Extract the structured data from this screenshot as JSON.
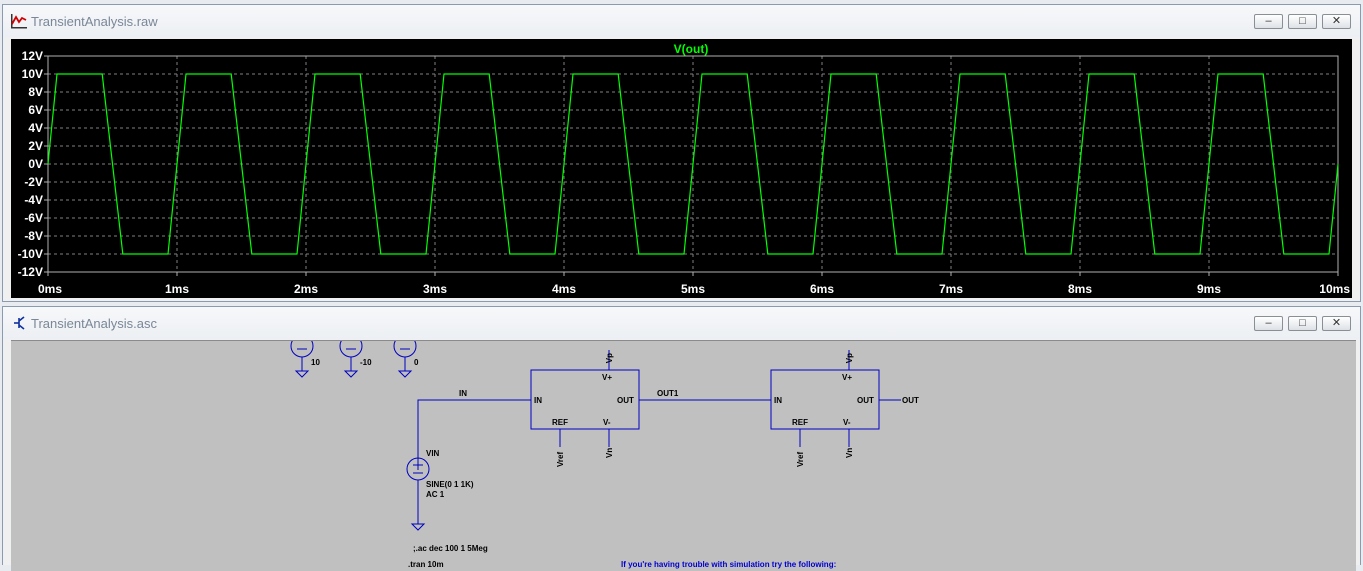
{
  "waveform_window": {
    "title": "TransientAnalysis.raw",
    "trace_label": "V(out)",
    "trace_color": "#00ff00",
    "buttons": {
      "minimize": "–",
      "restore": "□",
      "close": "✕"
    }
  },
  "chart_data": {
    "type": "line",
    "title": "V(out)",
    "xlabel": "",
    "ylabel": "",
    "x_ticks": [
      "0ms",
      "1ms",
      "2ms",
      "3ms",
      "4ms",
      "5ms",
      "6ms",
      "7ms",
      "8ms",
      "9ms",
      "10ms"
    ],
    "y_ticks": [
      "12V",
      "10V",
      "8V",
      "6V",
      "4V",
      "2V",
      "0V",
      "-2V",
      "-4V",
      "-6V",
      "-8V",
      "-10V",
      "-12V"
    ],
    "xlim": [
      0,
      10
    ],
    "ylim": [
      -12,
      12
    ],
    "grid": true,
    "series": [
      {
        "name": "V(out)",
        "x_units": "ms",
        "y_units": "V",
        "x": [
          0,
          0.07,
          0.42,
          0.58,
          0.93,
          1.07,
          1.42,
          1.58,
          1.93,
          2.07,
          2.42,
          2.58,
          2.93,
          3.07,
          3.42,
          3.58,
          3.93,
          4.07,
          4.42,
          4.58,
          4.93,
          5.07,
          5.42,
          5.58,
          5.93,
          6.07,
          6.42,
          6.58,
          6.93,
          7.07,
          7.42,
          7.58,
          7.93,
          8.07,
          8.42,
          8.58,
          8.93,
          9.07,
          9.42,
          9.58,
          9.93,
          10
        ],
        "y": [
          0,
          10,
          10,
          -10,
          -10,
          10,
          10,
          -10,
          -10,
          10,
          10,
          -10,
          -10,
          10,
          10,
          -10,
          -10,
          10,
          10,
          -10,
          -10,
          10,
          10,
          -10,
          -10,
          10,
          10,
          -10,
          -10,
          10,
          10,
          -10,
          -10,
          10,
          10,
          -10,
          -10,
          10,
          10,
          -10,
          -10,
          0
        ]
      }
    ]
  },
  "schematic_window": {
    "title": "TransientAnalysis.asc",
    "buttons": {
      "minimize": "–",
      "restore": "□",
      "close": "✕"
    },
    "colors": {
      "wire": "#0000c0",
      "background": "#c0c0c0",
      "text": "#000000",
      "comment": "#0000d0"
    },
    "supplies": [
      {
        "value": "10"
      },
      {
        "value": "-10"
      },
      {
        "value": "0"
      }
    ],
    "nets": {
      "in": "IN",
      "out1": "OUT1",
      "out": "OUT"
    },
    "amplifiers": [
      {
        "in": "IN",
        "out": "OUT",
        "vplus": "V+",
        "vminus": "V-",
        "ref": "REF",
        "top_net": "Vp",
        "ref_net": "Vref",
        "bottom_net": "Vn"
      },
      {
        "in": "IN",
        "out": "OUT",
        "vplus": "V+",
        "vminus": "V-",
        "ref": "REF",
        "top_net": "Vp",
        "ref_net": "Vref",
        "bottom_net": "Vn"
      }
    ],
    "source": {
      "name": "VIN",
      "value1": "SINE(0 1 1K)",
      "value2": "AC 1"
    },
    "directives": [
      ";.ac dec 100 1 5Meg",
      ".tran 10m"
    ],
    "comment": "If you're having trouble with simulation try the following:"
  }
}
